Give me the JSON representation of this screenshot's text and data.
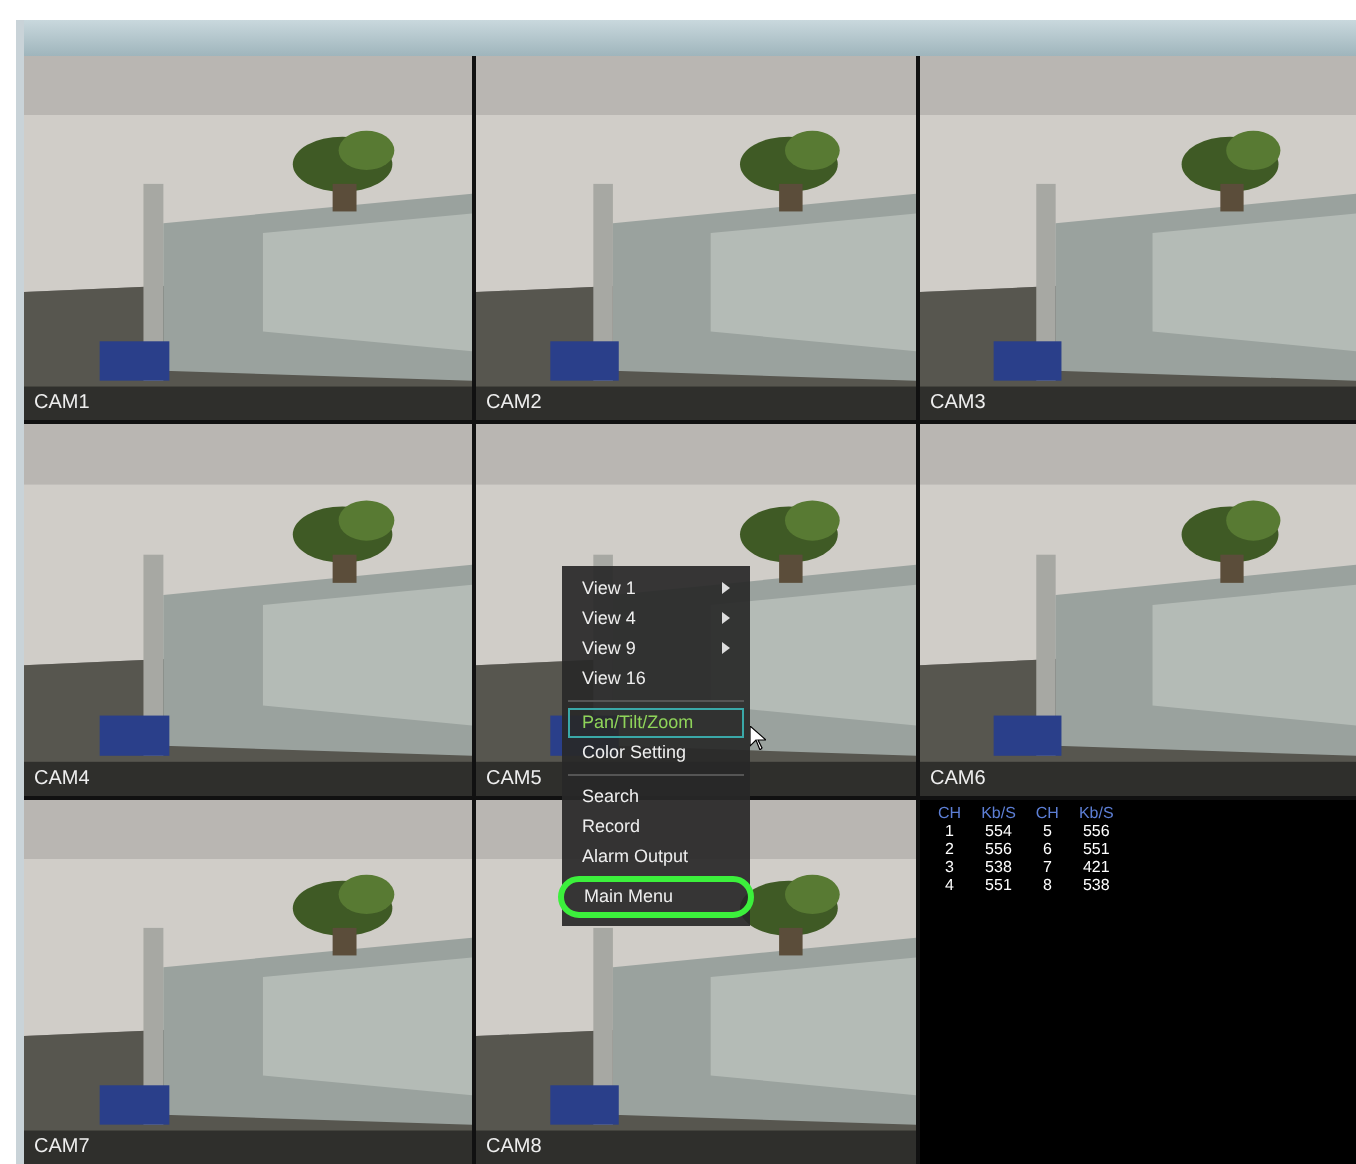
{
  "cameras": [
    {
      "label": "CAM1"
    },
    {
      "label": "CAM2"
    },
    {
      "label": "CAM3"
    },
    {
      "label": "CAM4"
    },
    {
      "label": "CAM5"
    },
    {
      "label": "CAM6"
    },
    {
      "label": "CAM7"
    },
    {
      "label": "CAM8"
    }
  ],
  "bitrate_table": {
    "columns": [
      "CH",
      "Kb/S",
      "CH",
      "Kb/S"
    ],
    "rows": [
      [
        "1",
        "554",
        "5",
        "556"
      ],
      [
        "2",
        "556",
        "6",
        "551"
      ],
      [
        "3",
        "538",
        "7",
        "421"
      ],
      [
        "4",
        "551",
        "8",
        "538"
      ]
    ]
  },
  "context_menu": {
    "groups": [
      [
        {
          "label": "View 1",
          "submenu": true,
          "selected": false,
          "circled": false
        },
        {
          "label": "View 4",
          "submenu": true,
          "selected": false,
          "circled": false
        },
        {
          "label": "View 9",
          "submenu": true,
          "selected": false,
          "circled": false
        },
        {
          "label": "View 16",
          "submenu": false,
          "selected": false,
          "circled": false
        }
      ],
      [
        {
          "label": "Pan/Tilt/Zoom",
          "submenu": false,
          "selected": true,
          "circled": false
        },
        {
          "label": "Color Setting",
          "submenu": false,
          "selected": false,
          "circled": false
        }
      ],
      [
        {
          "label": "Search",
          "submenu": false,
          "selected": false,
          "circled": false
        },
        {
          "label": "Record",
          "submenu": false,
          "selected": false,
          "circled": false
        },
        {
          "label": "Alarm Output",
          "submenu": false,
          "selected": false,
          "circled": false
        },
        {
          "label": "Main Menu",
          "submenu": false,
          "selected": false,
          "circled": true
        }
      ]
    ]
  }
}
